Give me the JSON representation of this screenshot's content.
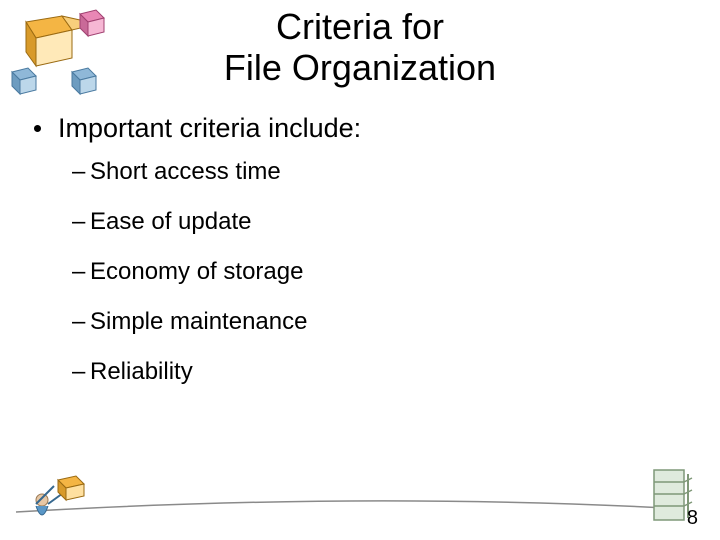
{
  "title_line1": "Criteria for",
  "title_line2": "File Organization",
  "intro": "Important criteria include:",
  "items": {
    "i0": "Short access time",
    "i1": "Ease of update",
    "i2": "Economy of storage",
    "i3": "Simple maintenance",
    "i4": "Reliability"
  },
  "page_number": "8"
}
